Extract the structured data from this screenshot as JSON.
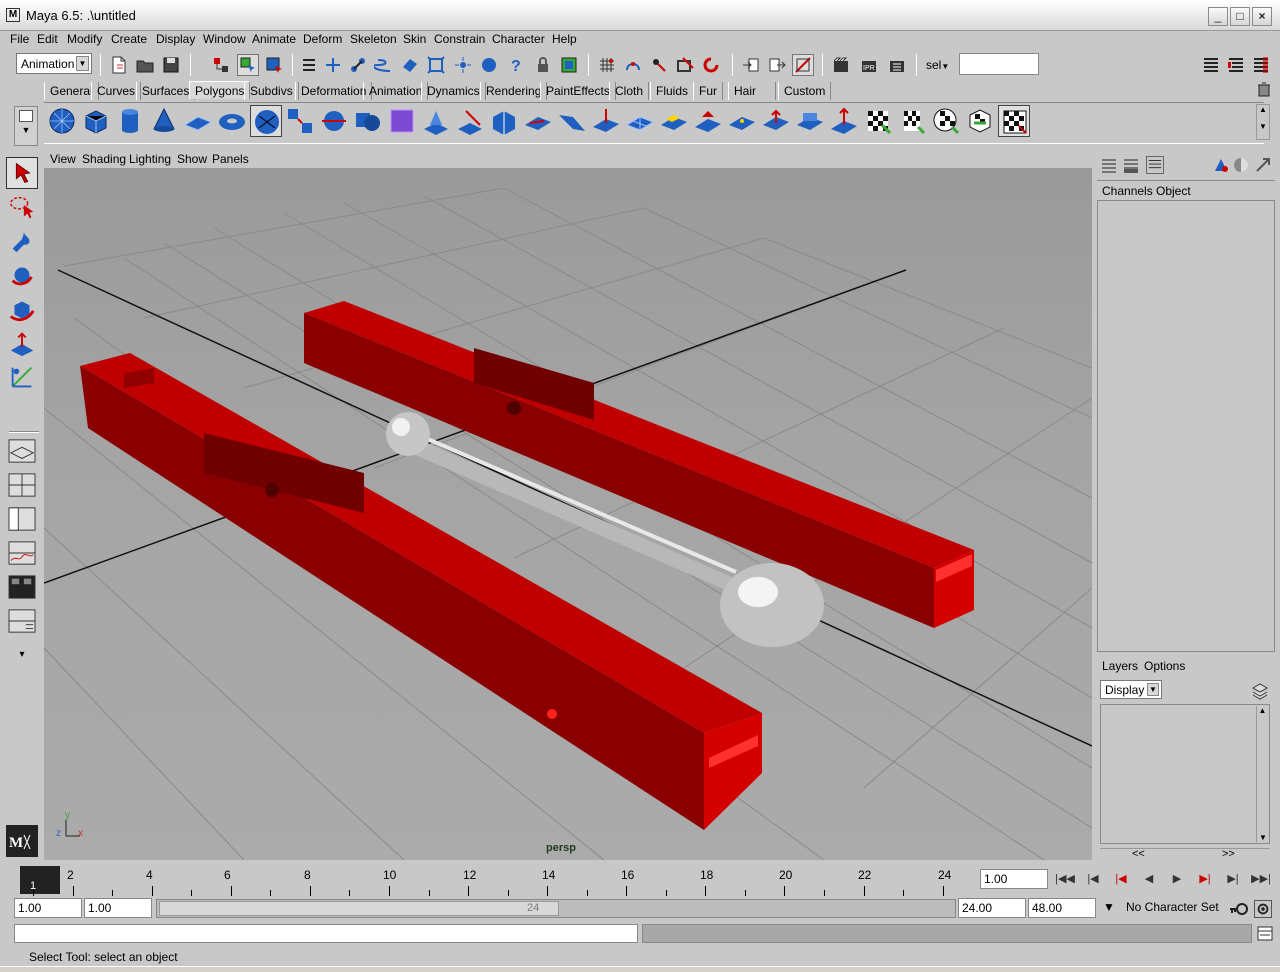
{
  "window": {
    "title": "Maya 6.5: .\\untitled",
    "minimize": "_",
    "maximize": "□",
    "close": "×"
  },
  "menubar": [
    "File",
    "Edit",
    "Modify",
    "Create",
    "Display",
    "Window",
    "Animate",
    "Deform",
    "Skeleton",
    "Skin",
    "Constrain",
    "Character",
    "Help"
  ],
  "statusline": {
    "mode": "Animation",
    "sel_label": "sel",
    "sel_value": ""
  },
  "shelf": {
    "tabs": [
      "General",
      "Curves",
      "Surfaces",
      "Polygons",
      "Subdivs",
      "Deformation",
      "Animation",
      "Dynamics",
      "Rendering",
      "PaintEffects",
      "Cloth",
      "Fluids",
      "Fur",
      "Hair",
      "Custom"
    ],
    "active_tab": "Polygons"
  },
  "panel": {
    "menus": [
      "View",
      "Shading",
      "Lighting",
      "Show",
      "Panels"
    ],
    "camera_label": "persp",
    "axis_y": "y",
    "axis_z": "z",
    "axis_x": "x"
  },
  "channelbox": {
    "tabs": [
      "Channels",
      "Object"
    ]
  },
  "layers": {
    "tabs": [
      "Layers",
      "Options"
    ],
    "mode": "Display",
    "scroll_left": "<<",
    "scroll_right": ">>"
  },
  "timeline": {
    "current_frame": "1",
    "labels": [
      "2",
      "4",
      "6",
      "8",
      "10",
      "12",
      "14",
      "16",
      "18",
      "20",
      "22",
      "24"
    ],
    "current_time": "1.00"
  },
  "range": {
    "start": "1.00",
    "playback_start": "1.00",
    "slider_end_label": "24",
    "playback_end": "24.00",
    "end": "48.00",
    "character_set": "No Character Set"
  },
  "helpline": {
    "text": "Select Tool: select an object"
  },
  "colors": {
    "viewport_bg": "#a3a3a3",
    "object_red": "#b00000",
    "object_grey": "#c0c0c0",
    "ui_bg": "#c8c8c8",
    "shelf_icon_blue": "#1f5fbf"
  }
}
